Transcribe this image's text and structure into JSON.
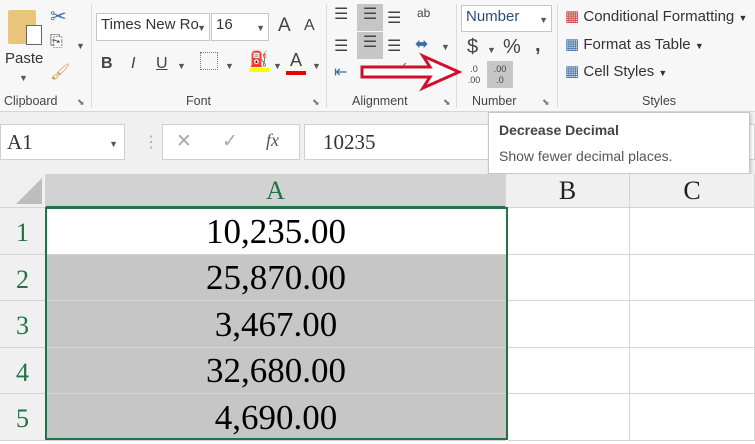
{
  "clipboard": {
    "paste": "Paste",
    "label": "Clipboard"
  },
  "font": {
    "name": "Times New Ro",
    "size": "16",
    "bold": "B",
    "italic": "I",
    "underline": "U",
    "label": "Font",
    "grow": "A",
    "shrink": "A",
    "font_color": "A"
  },
  "alignment": {
    "label": "Alignment",
    "wrap": "ab"
  },
  "number": {
    "format": "Number",
    "currency": "$",
    "percent": "%",
    "comma": ",",
    "label": "Number",
    "increase": ".0\n.00",
    "decrease": ".00\n.0"
  },
  "styles": {
    "conditional": "Conditional Formatting",
    "table": "Format as Table",
    "cell_styles": "Cell Styles",
    "label": "Styles"
  },
  "formula_bar": {
    "name_box": "A1",
    "cancel": "✕",
    "enter": "✓",
    "fx": "fx",
    "value": "10235"
  },
  "tooltip": {
    "title": "Decrease Decimal",
    "desc": "Show fewer decimal places."
  },
  "columns": [
    "A",
    "B",
    "C"
  ],
  "rows": [
    {
      "n": "1",
      "a": "10,235.00"
    },
    {
      "n": "2",
      "a": "25,870.00"
    },
    {
      "n": "3",
      "a": "3,467.00"
    },
    {
      "n": "4",
      "a": "32,680.00"
    },
    {
      "n": "5",
      "a": "4,690.00"
    }
  ],
  "colors": {
    "accent": "#217346",
    "arrow": "#d0102a"
  }
}
